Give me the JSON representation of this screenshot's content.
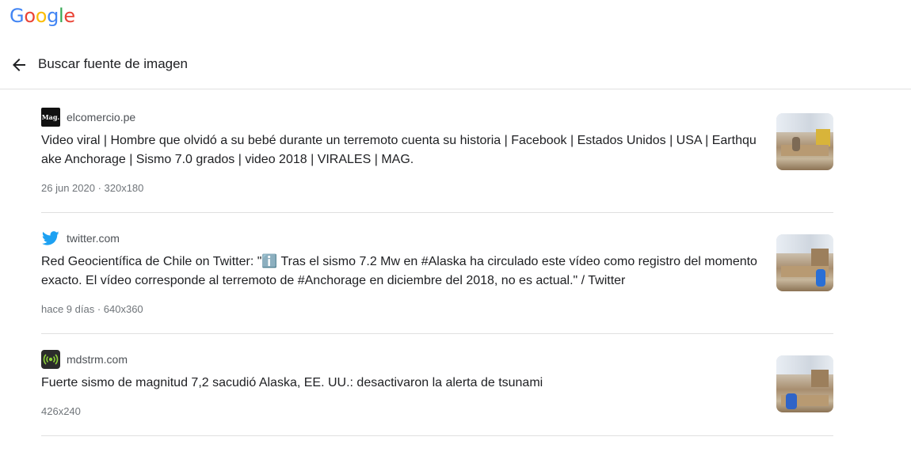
{
  "logo": {
    "letters": [
      "G",
      "o",
      "o",
      "g",
      "l",
      "e"
    ],
    "colors": [
      "#4285F4",
      "#EA4335",
      "#FBBC05",
      "#4285F4",
      "#34A853",
      "#EA4335"
    ]
  },
  "header": {
    "back_icon": "arrow-left-icon",
    "title": "Buscar fuente de imagen"
  },
  "results": [
    {
      "favicon": "mag-icon",
      "favicon_text": "Mag.",
      "domain": "elcomercio.pe",
      "title": "Video viral | Hombre que olvidó a su bebé durante un terremoto cuenta su historia | Facebook | Estados Unidos | USA | Earthquake Anchorage | Sismo 7.0 grados | video 2018 | VIRALES | MAG.",
      "meta": "26 jun 2020 · 320x180"
    },
    {
      "favicon": "twitter-bird-icon",
      "domain": "twitter.com",
      "title_before": "Red Geocientífica de Chile on Twitter: \"",
      "title_emoji": "ℹ️",
      "title_after": " Tras el sismo 7.2 Mw en #Alaska ha circulado este vídeo como registro del momento exacto. El vídeo corresponde al terremoto de #Anchorage en diciembre del 2018, no es actual.\" / Twitter",
      "meta": "hace 9 días · 640x360"
    },
    {
      "favicon": "signal-broadcast-icon",
      "domain": "mdstrm.com",
      "title": "Fuerte sismo de magnitud 7,2 sacudió Alaska, EE. UU.: desactivaron la alerta de tsunami",
      "meta": "426x240"
    }
  ]
}
